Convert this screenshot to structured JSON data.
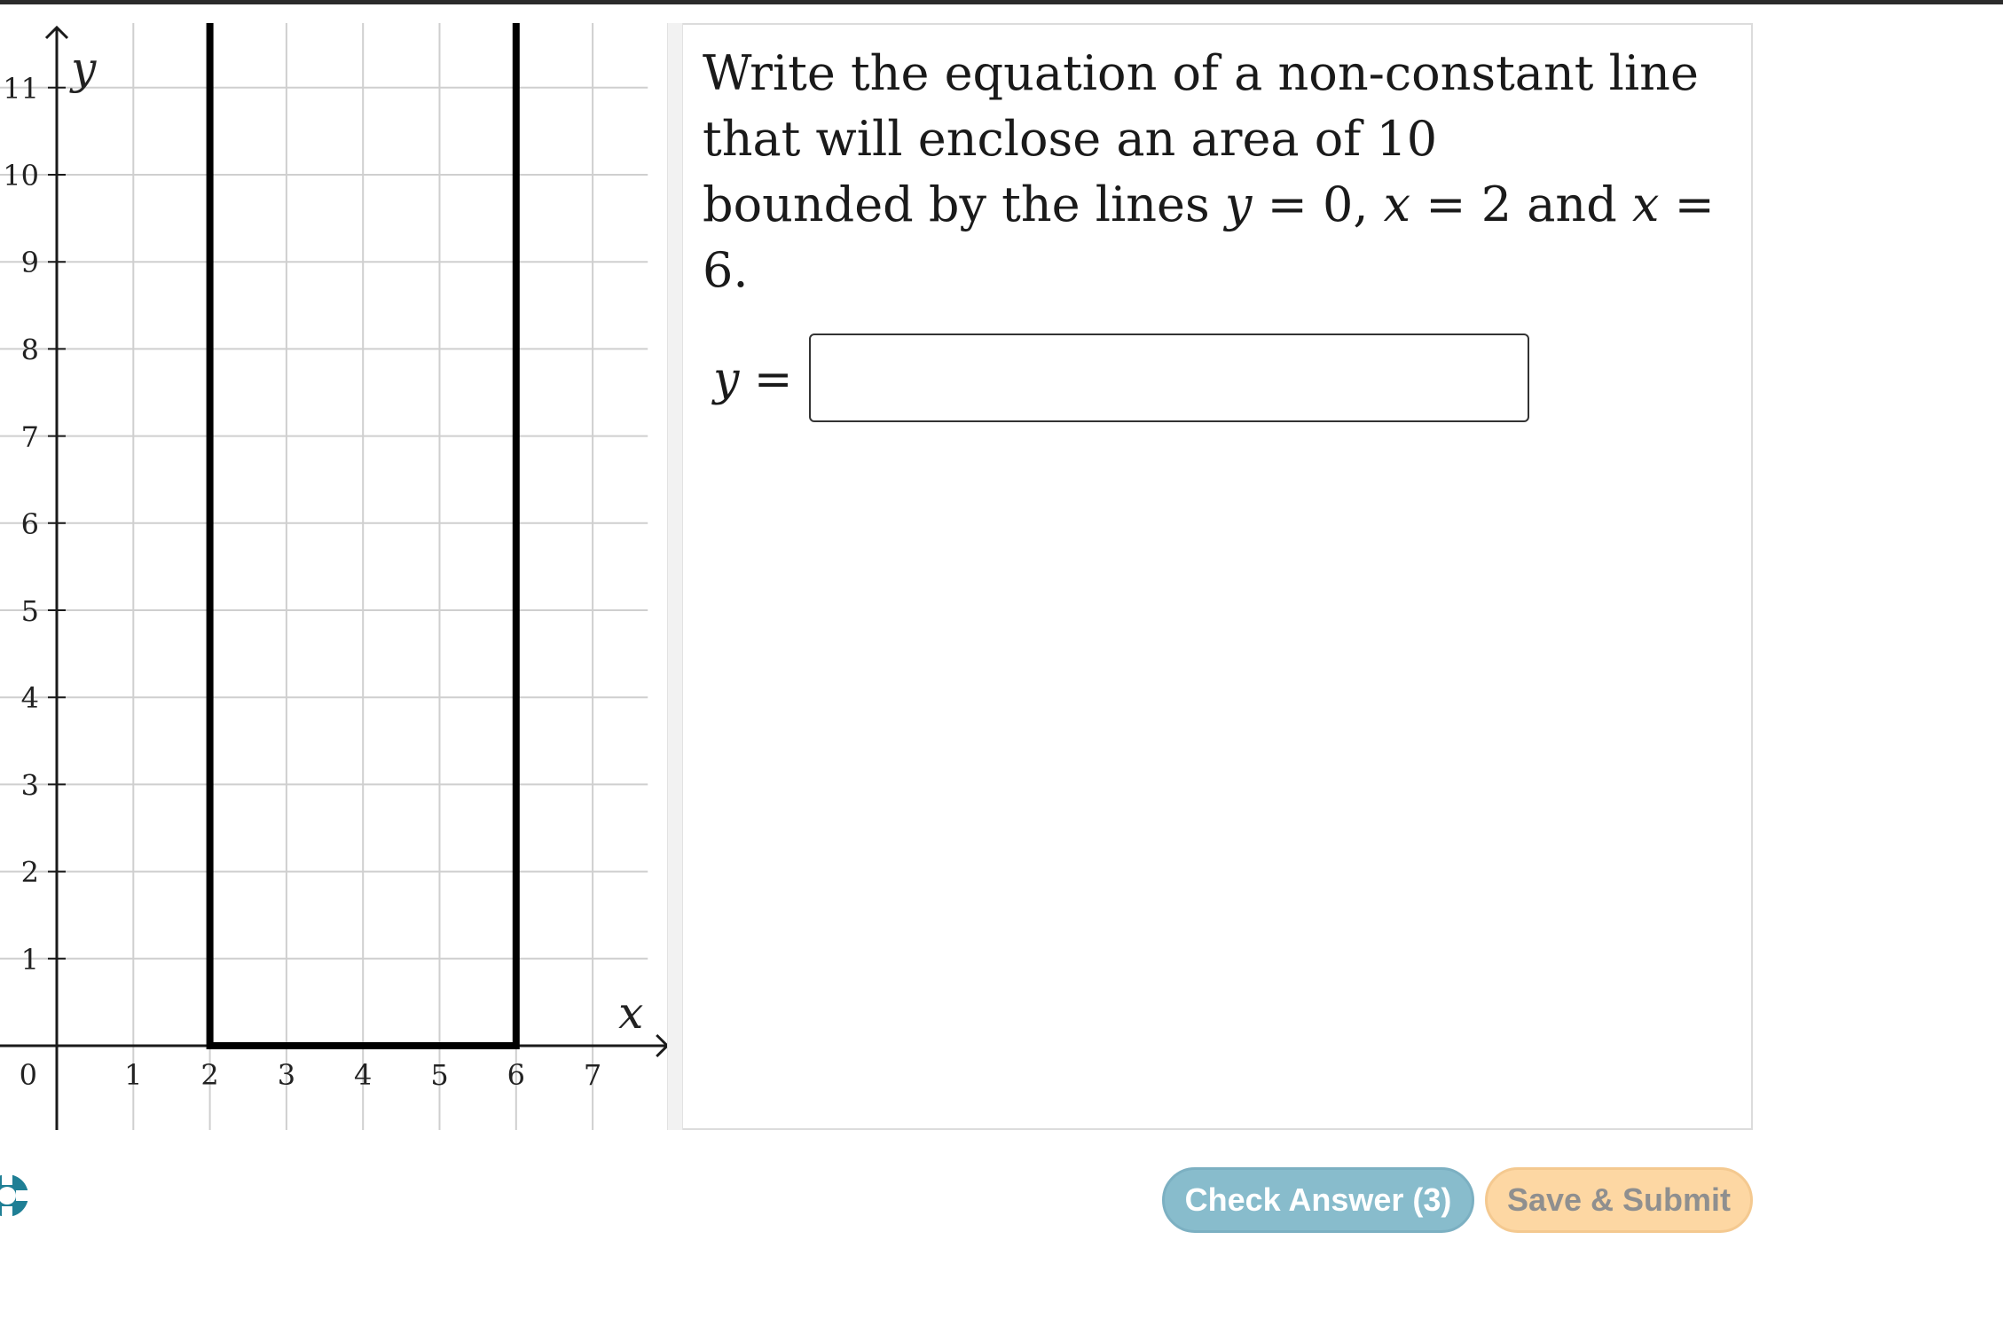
{
  "graph": {
    "x_axis_label": "x",
    "y_axis_label": "y",
    "origin_label": "0",
    "x_ticks": [
      "1",
      "2",
      "3",
      "4",
      "5",
      "6",
      "7"
    ],
    "y_ticks": [
      "1",
      "2",
      "3",
      "4",
      "5",
      "6",
      "7",
      "8",
      "9",
      "10",
      "11"
    ],
    "region": {
      "x_left": 2,
      "x_right": 6,
      "y_bottom": 0
    },
    "colors": {
      "grid": "#cfcfcf",
      "axis": "#1a1a1a",
      "region": "#000000"
    }
  },
  "question": {
    "line1": "Write the equation of a non-constant line",
    "line2": "that will enclose an area of 10",
    "line3_prefix": "bounded by the lines ",
    "eq1_var": "y",
    "eq1_rest": " = 0,  ",
    "eq2_var": "x",
    "eq2_rest": " = 2 and ",
    "eq3_var": "x",
    "eq3_rest": " = 6."
  },
  "answer": {
    "label_var": "y",
    "label_eq": " =",
    "value": "",
    "placeholder": ""
  },
  "buttons": {
    "check_answer": "Check Answer (3)",
    "save_submit": "Save & Submit"
  },
  "icons": {
    "help": "help-lifebuoy-icon"
  }
}
